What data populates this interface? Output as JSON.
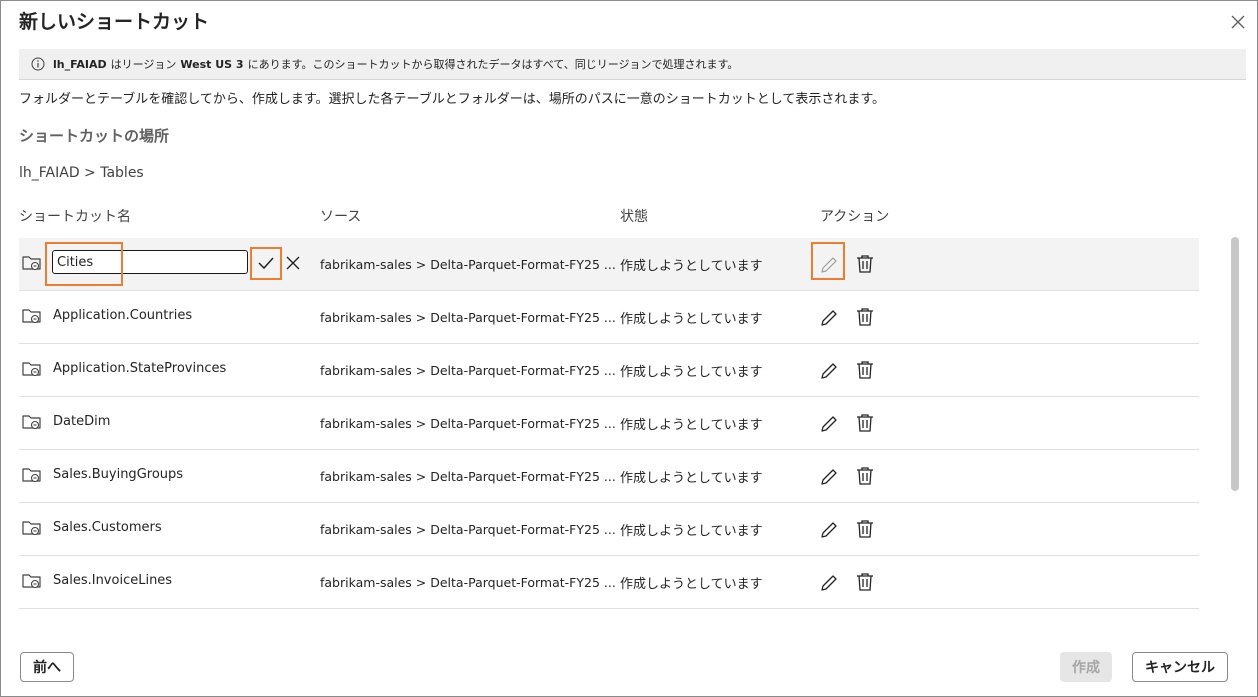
{
  "dialog": {
    "title": "新しいショートカット",
    "info": {
      "lakehouse": "lh_FAIAD",
      "text_1": "はリージョン",
      "region": "West US 3",
      "text_2": "にあります。このショートカットから取得されたデータはすべて、同じリージョンで処理されます。"
    },
    "description": "フォルダーとテーブルを確認してから、作成します。選択した各テーブルとフォルダーは、場所のパスに一意のショートカットとして表示されます。",
    "section_title": "ショートカットの場所",
    "breadcrumb": "lh_FAIAD > Tables"
  },
  "table": {
    "headers": {
      "name": "ショートカット名",
      "source": "ソース",
      "status": "状態",
      "actions": "アクション"
    },
    "editing_row": {
      "input_value": "Cities",
      "source": "fabrikam-sales > Delta-Parquet-Format-FY25 ...",
      "status": "作成しようとしています"
    },
    "rows": [
      {
        "name": "Application.Countries",
        "source": "fabrikam-sales > Delta-Parquet-Format-FY25 ...",
        "status": "作成しようとしています"
      },
      {
        "name": "Application.StateProvinces",
        "source": "fabrikam-sales > Delta-Parquet-Format-FY25 ...",
        "status": "作成しようとしています"
      },
      {
        "name": "DateDim",
        "source": "fabrikam-sales > Delta-Parquet-Format-FY25 ...",
        "status": "作成しようとしています"
      },
      {
        "name": "Sales.BuyingGroups",
        "source": "fabrikam-sales > Delta-Parquet-Format-FY25 ...",
        "status": "作成しようとしています"
      },
      {
        "name": "Sales.Customers",
        "source": "fabrikam-sales > Delta-Parquet-Format-FY25 ...",
        "status": "作成しようとしています"
      },
      {
        "name": "Sales.InvoiceLines",
        "source": "fabrikam-sales > Delta-Parquet-Format-FY25 ...",
        "status": "作成しようとしています"
      }
    ]
  },
  "footer": {
    "back_label": "前へ",
    "create_label": "作成",
    "cancel_label": "キャンセル"
  },
  "colors": {
    "highlight": "#ed7d31",
    "selected_row": "#f3f3f3",
    "info_bg": "#f0f0f0",
    "disabled_button": "#e6e6e6"
  },
  "icons": [
    "close-icon",
    "info-icon",
    "folder-link-icon",
    "checkmark-icon",
    "dismiss-icon",
    "edit-pencil-icon",
    "trash-icon"
  ]
}
